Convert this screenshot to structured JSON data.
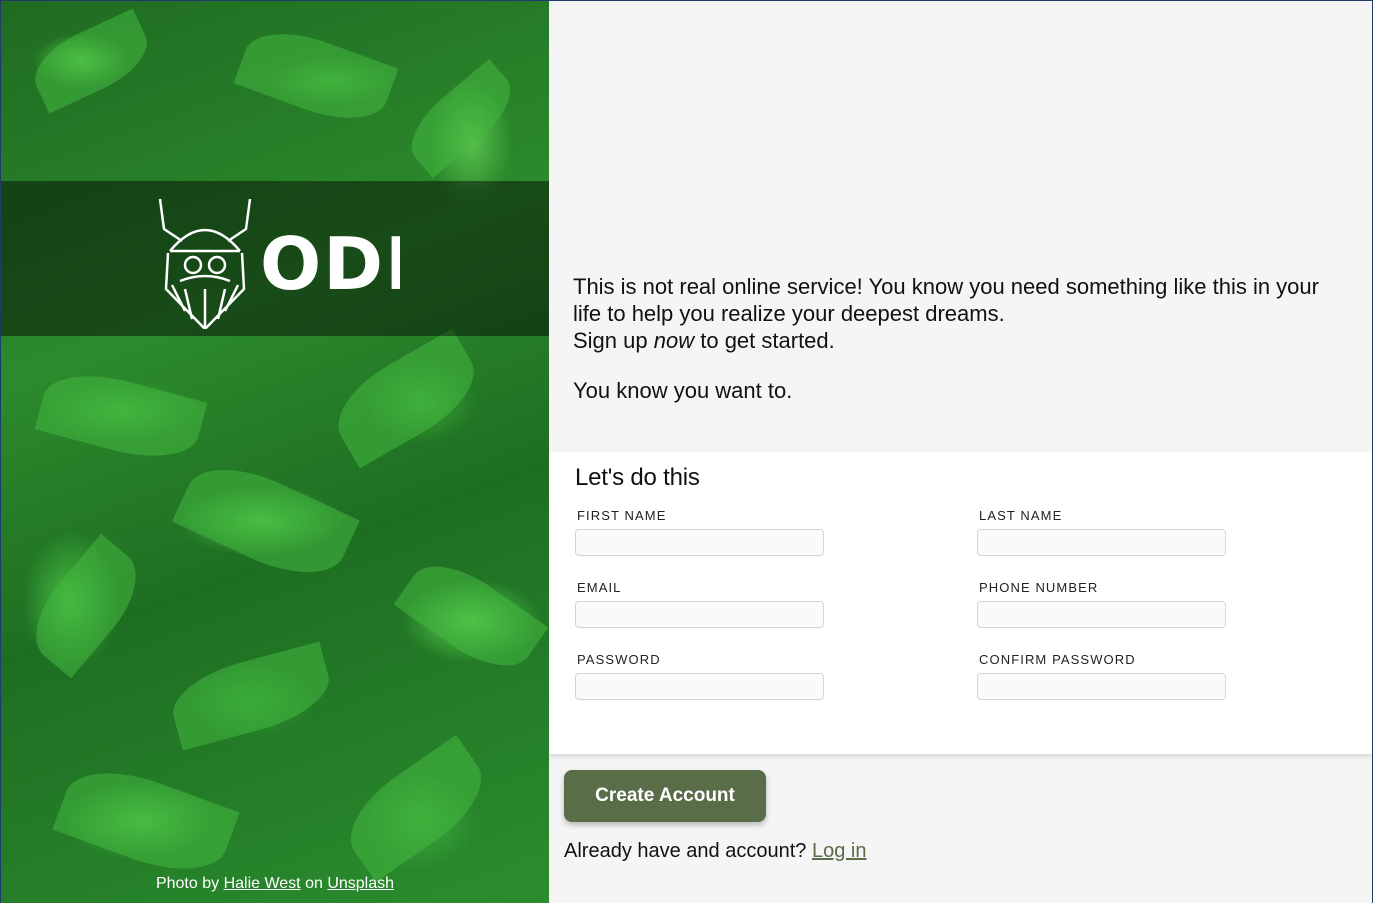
{
  "left": {
    "logo_text": "ODIN",
    "credit_prefix": "Photo by",
    "credit_author": "Halie West",
    "credit_middle": "on",
    "credit_site": "Unsplash"
  },
  "intro": {
    "line1": "This is not real online service! You know you need something like this in your life to help you realize your deepest dreams.",
    "line2_before": "Sign up",
    "line2_em": "now",
    "line2_after": "to get started.",
    "line3": "You know you want to."
  },
  "form": {
    "heading": "Let's do this",
    "fields": {
      "first_name": {
        "label": "FIRST NAME",
        "value": ""
      },
      "last_name": {
        "label": "LAST NAME",
        "value": ""
      },
      "email": {
        "label": "EMAIL",
        "value": ""
      },
      "phone": {
        "label": "PHONE NUMBER",
        "value": ""
      },
      "password": {
        "label": "PASSWORD",
        "value": ""
      },
      "confirm_password": {
        "label": "CONFIRM PASSWORD",
        "value": ""
      }
    }
  },
  "actions": {
    "create_label": "Create Account",
    "login_prompt": "Already have and account?",
    "login_link": "Log in"
  },
  "colors": {
    "accent": "#596d48",
    "panel_bg": "#f5f5f5",
    "card_bg": "#ffffff"
  }
}
